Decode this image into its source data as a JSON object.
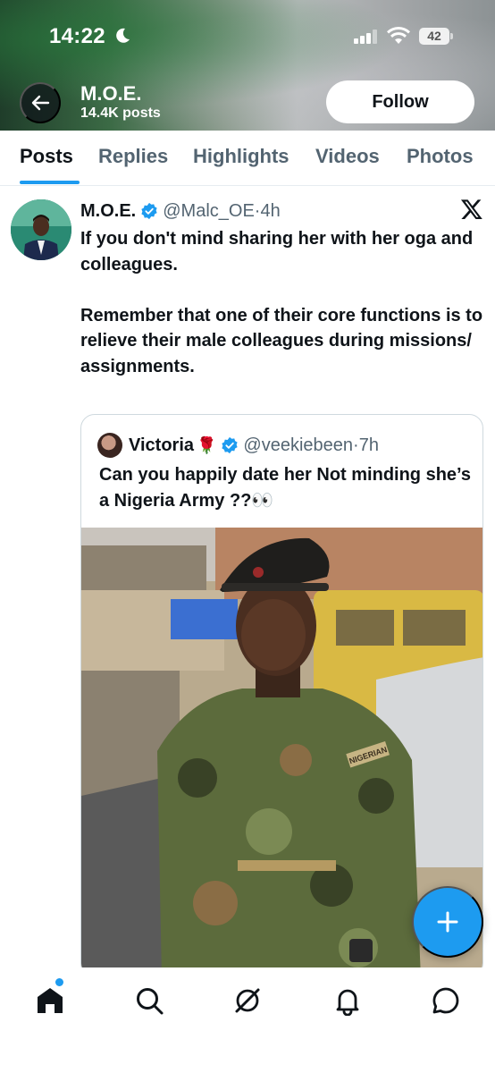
{
  "status_bar": {
    "time": "14:22",
    "battery": "42"
  },
  "header": {
    "profile_name": "M.O.E.",
    "post_count": "14.4K posts",
    "follow_label": "Follow"
  },
  "tabs": [
    {
      "label": "Posts",
      "active": true
    },
    {
      "label": "Replies",
      "active": false
    },
    {
      "label": "Highlights",
      "active": false
    },
    {
      "label": "Videos",
      "active": false
    },
    {
      "label": "Photos",
      "active": false
    }
  ],
  "tweet": {
    "author_name": "M.O.E.",
    "handle": "@Malc_OE",
    "separator": "·",
    "time": "4h",
    "paragraph_1": "If you don't mind sharing her with her oga and colleagues.",
    "paragraph_2": "Remember that one of their core functions is to relieve their male colleagues during missions/ assignments.",
    "source_icon": "x-logo-icon"
  },
  "quoted_tweet": {
    "author_name": "Victoria",
    "author_emoji": "🌹",
    "handle": "@veekiebeen",
    "separator": "·",
    "time": "7h",
    "text": "Can you happily date her Not minding she’s a Nigeria Army ??👀",
    "image_badge": "NIGERIAN"
  },
  "nav": {
    "items": [
      "home-icon",
      "search-icon",
      "grok-icon",
      "notifications-icon",
      "messages-icon"
    ]
  },
  "colors": {
    "accent": "#1d9bf0",
    "text": "#0f1419",
    "secondary": "#536471"
  }
}
